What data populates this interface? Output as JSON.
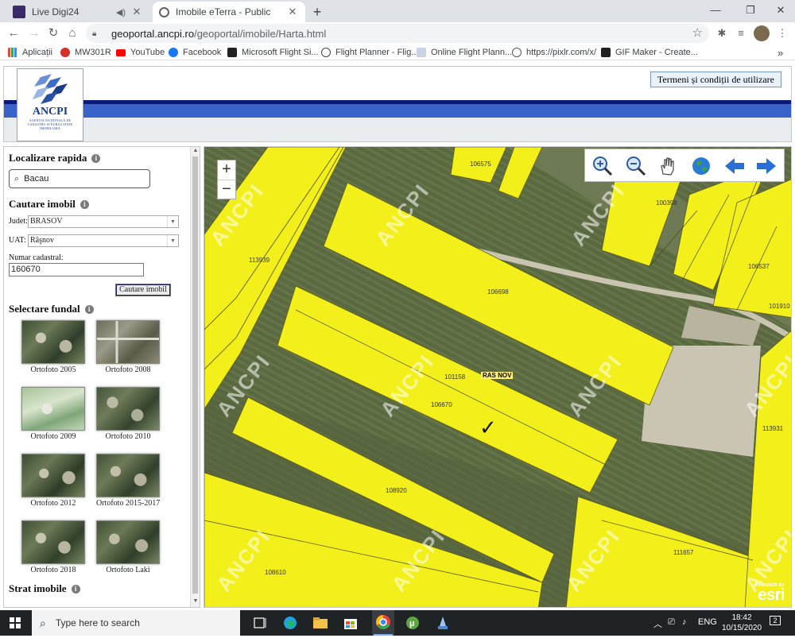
{
  "browser": {
    "tabs": [
      {
        "title": "Live Digi24",
        "active": false
      },
      {
        "title": "Imobile eTerra - Public",
        "active": true
      }
    ],
    "address": {
      "host": "geoportal.ancpi.ro",
      "path": "/geoportal/imobile/Harta.html"
    },
    "bookmarks": [
      "Aplicații",
      "MW301R",
      "YouTube",
      "Facebook",
      "Microsoft Flight Si...",
      "Flight Planner - Flig...",
      "Online Flight Plann...",
      "https://pixlr.com/x/",
      "GIF Maker - Create..."
    ],
    "bookmarks_overflow": "»"
  },
  "header": {
    "logo_title": "ANCPI",
    "logo_subtitle": "AGENȚIA NAȚIONALĂ DE CADASTRU ȘI PUBLICITATE IMOBILIARĂ",
    "terms_button": "Termeni și condiții de utilizare"
  },
  "panel": {
    "quick_locate": {
      "title": "Localizare rapida",
      "value": "Bacau"
    },
    "property_search": {
      "title": "Cautare imobil",
      "county_label": "Judet:",
      "county_value": "BRASOV",
      "uat_label": "UAT:",
      "uat_value": "Râşnov",
      "cadastral_label": "Numar cadastral:",
      "cadastral_value": "160670",
      "search_button": "Cautare imobil"
    },
    "basemap": {
      "title": "Selectare fundal",
      "items": [
        "Ortofoto 2005",
        "Ortofoto 2008",
        "Ortofoto 2009",
        "Ortofoto 2010",
        "Ortofoto 2012",
        "Ortofoto 2015-2017",
        "Ortofoto 2018",
        "Ortofoto Laki"
      ]
    },
    "layers": {
      "title": "Strat imobile"
    }
  },
  "map": {
    "zoom_in": "+",
    "zoom_out": "−",
    "watermark": "ANCPI",
    "parcels": [
      "106575",
      "100398",
      "113939",
      "106537",
      "106698",
      "101910",
      "101158",
      "106670",
      "113931",
      "108920",
      "111657",
      "108610"
    ],
    "place_label": "RAS NOV",
    "attribution_small": "POWERED BY",
    "attribution": "esri",
    "colors": {
      "parcel": "#f2ef1a",
      "field": "#5a6740"
    }
  },
  "taskbar": {
    "search_placeholder": "Type here to search",
    "lang": "ENG",
    "time": "18:42",
    "date": "10/15/2020",
    "notifications": "2"
  }
}
